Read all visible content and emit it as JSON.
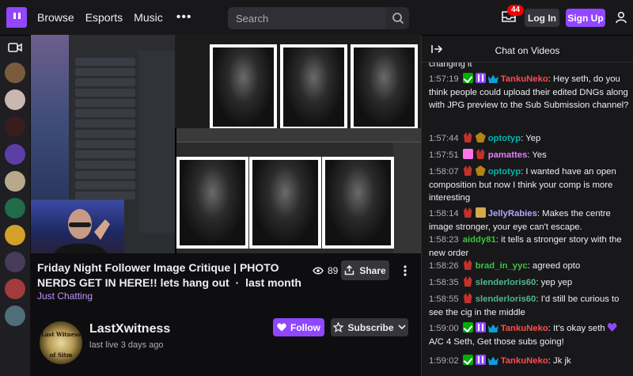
{
  "nav": {
    "links": [
      "Browse",
      "Esports",
      "Music"
    ],
    "more": "•••",
    "search_placeholder": "Search",
    "inbox_count": "44",
    "login": "Log In",
    "signup": "Sign Up"
  },
  "video": {
    "title": "Friday Night Follower Image Critique | PHOTO NERDS GET IN HERE!! lets hang out",
    "separator": "·",
    "age": "last month",
    "category": "Just Chatting",
    "views": "89",
    "share": "Share"
  },
  "channel": {
    "name": "LastXwitness",
    "status": "last live 3 days ago",
    "follow": "Follow",
    "subscribe": "Subscribe",
    "avatar_text_top": "Last Witness",
    "avatar_text_bottom": "of Sitm"
  },
  "chat": {
    "header": "Chat on Videos",
    "messages": [
      {
        "ts": "",
        "badges": [],
        "user": "",
        "color": "#efeff1",
        "text": "changing it"
      },
      {
        "ts": "1:57:19",
        "badges": [
          "mod",
          "sub",
          "prime"
        ],
        "user": "TankuNeko",
        "color": "#ff4b4b",
        "text": "Hey seth, do you think people could upload their edited DNGs along with JPG preview to the Sub Submission channel?"
      },
      {
        "ts": "1:57:44",
        "badges": [
          "horn",
          "bits"
        ],
        "user": "optotyp",
        "color": "#00b5ad",
        "text": "Yep"
      },
      {
        "ts": "1:57:51",
        "badges": [
          "heart",
          "horn"
        ],
        "user": "pamattes",
        "color": "#eb7bff",
        "text": "Yes"
      },
      {
        "ts": "1:58:07",
        "badges": [
          "horn",
          "bits"
        ],
        "user": "optotyp",
        "color": "#00b5ad",
        "text": "I wanted have an open composition but now I think your comp is more interesting"
      },
      {
        "ts": "1:58:14",
        "badges": [
          "horn",
          "gift"
        ],
        "user": "JellyRabies",
        "color": "#b9a3ff",
        "text": "Makes the centre image stronger, your eye can't escape."
      },
      {
        "ts": "1:58:23",
        "badges": [],
        "user": "aiddy81",
        "color": "#3bc43b",
        "text": "it tells a stronger story with the new order"
      },
      {
        "ts": "1:58:26",
        "badges": [
          "horn"
        ],
        "user": "brad_in_yyc",
        "color": "#3bc43b",
        "text": "agreed opto"
      },
      {
        "ts": "1:58:35",
        "badges": [
          "horn"
        ],
        "user": "slenderloris60",
        "color": "#4db88a",
        "text": "yep yep"
      },
      {
        "ts": "1:58:55",
        "badges": [
          "horn"
        ],
        "user": "slenderloris60",
        "color": "#4db88a",
        "text": "I'd still be curious to see the cig in the middle"
      },
      {
        "ts": "1:59:00",
        "badges": [
          "mod",
          "sub",
          "prime"
        ],
        "user": "TankuNeko",
        "color": "#ff4b4b",
        "text": "It's okay seth",
        "emote": "heart-emote",
        "text2": "A/C 4 Seth, Get those subs going!"
      },
      {
        "ts": "1:59:02",
        "badges": [
          "mod",
          "sub",
          "prime"
        ],
        "user": "TankuNeko",
        "color": "#ff4b4b",
        "text": "Jk jk"
      }
    ]
  },
  "colors": {
    "brand": "#9147ff",
    "badge_red": "#eb0400",
    "category_link": "#bf94ff"
  },
  "rail_avatar_colors": [
    "#7a5b3c",
    "#c9b7b0",
    "#3a1c1c",
    "#5b3fa6",
    "#b8a98c",
    "#1f6b4a",
    "#d4a02a",
    "#463c5a",
    "#a23b3b",
    "#4f6d7a"
  ]
}
